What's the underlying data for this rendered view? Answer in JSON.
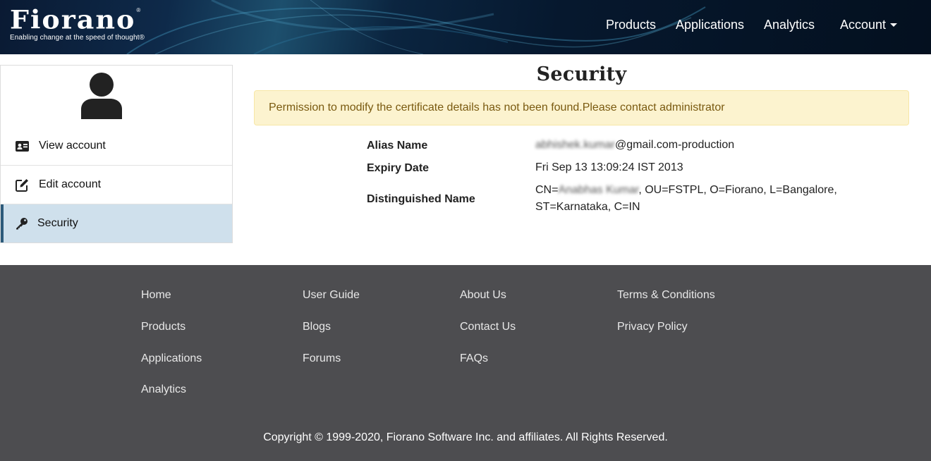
{
  "brand": {
    "name": "Fiorano",
    "registered_mark": "®",
    "tagline": "Enabling change at the speed of thought®"
  },
  "nav": {
    "items": [
      "Products",
      "Applications",
      "Analytics"
    ],
    "account_label": "Account"
  },
  "sidebar": {
    "items": [
      {
        "label": "View account",
        "icon": "id-card-icon"
      },
      {
        "label": "Edit account",
        "icon": "edit-icon"
      },
      {
        "label": "Security",
        "icon": "key-icon",
        "active": true
      }
    ]
  },
  "main": {
    "title": "Security",
    "alert": "Permission to modify the certificate details has not been found.Please contact administrator",
    "details": {
      "alias_label": "Alias Name",
      "alias_redacted": "abhishek.kumar",
      "alias_suffix": "@gmail.com-production",
      "expiry_label": "Expiry Date",
      "expiry_value": "Fri Sep 13 13:09:24 IST 2013",
      "dn_label": "Distinguished Name",
      "dn_prefix": "CN=",
      "dn_redacted": "Anabhas Kumar",
      "dn_line1_rest": ", OU=FSTPL, O=Fiorano, L=Bangalore,",
      "dn_line2": "ST=Karnataka, C=IN"
    }
  },
  "footer": {
    "col1": [
      "Home",
      "Products",
      "Applications",
      "Analytics"
    ],
    "col2": [
      "User Guide",
      "Blogs",
      "Forums"
    ],
    "col3": [
      "About Us",
      "Contact Us",
      "FAQs"
    ],
    "col4": [
      "Terms & Conditions",
      "Privacy Policy"
    ],
    "copyright": "Copyright © 1999-2020, Fiorano Software Inc. and affiliates. All Rights Reserved."
  },
  "colors": {
    "header_bg": "#06182e",
    "alert_bg": "#fcf3cf",
    "alert_text": "#7a5a10",
    "active_item_bg": "#cfe0ec",
    "active_item_border": "#2c5a7a",
    "footer_bg": "#4d4d50"
  }
}
